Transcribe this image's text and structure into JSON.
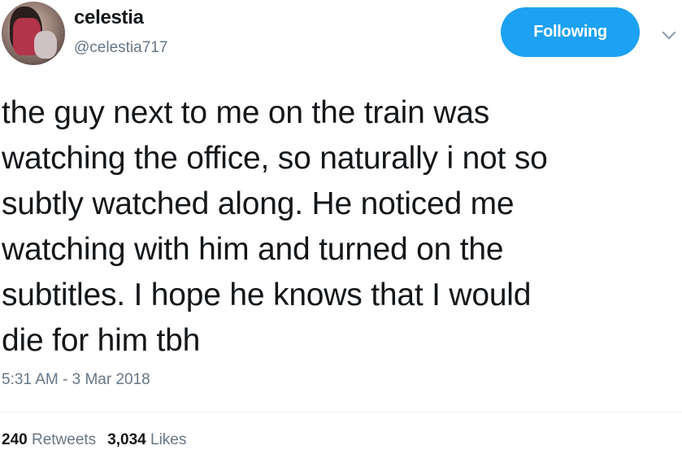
{
  "user": {
    "display_name": "celestia",
    "handle": "@celestia717"
  },
  "follow_button": {
    "label": "Following",
    "color": "#1da1f2"
  },
  "menu": {
    "icon": "chevron-down-icon"
  },
  "tweet": {
    "text": "the guy next to me on the train was\nwatching the office, so naturally i not so\nsubtly watched along. He noticed me\nwatching with him and turned on the\nsubtitles. I hope he knows that I would\ndie for him tbh",
    "timestamp": "5:31 AM - 3 Mar 2018"
  },
  "stats": {
    "retweets_count": "240",
    "retweets_label": "Retweets",
    "likes_count": "3,034",
    "likes_label": "Likes"
  }
}
